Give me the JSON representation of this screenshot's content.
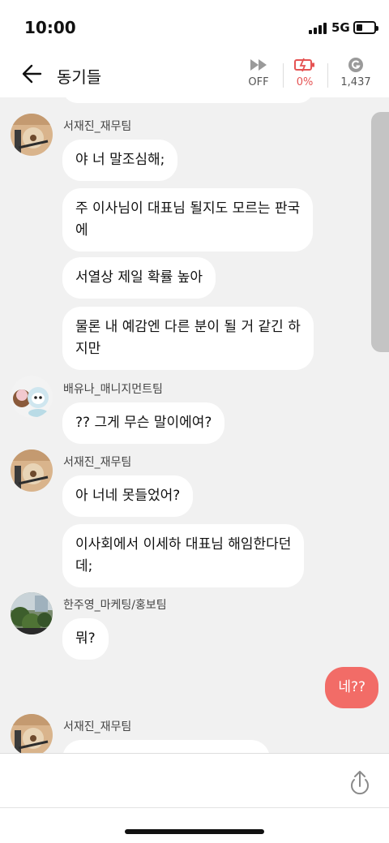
{
  "status_bar": {
    "time": "10:00",
    "network": "5G",
    "battery_level": 0.35
  },
  "header": {
    "title": "동기들",
    "autoplay_label": "OFF",
    "battery_label": "0%",
    "coin_label": "1,437"
  },
  "messages": [
    {
      "sender": "서재진_재무팀",
      "bubbles": [
        "야 너 말조심해;",
        "주 이사님이 대표님 될지도 모르는 판국\n에",
        "서열상 제일 확률 높아",
        "물론 내 예감엔 다른 분이 될 거 같긴 하\n지만"
      ]
    },
    {
      "sender": "배유나_매니지먼트팀",
      "bubbles": [
        "?? 그게 무슨 말이에여?"
      ]
    },
    {
      "sender": "서재진_재무팀",
      "bubbles": [
        "아 너네 못들었어?",
        "이사회에서 이세하 대표님 해임한다던\n데;"
      ]
    },
    {
      "sender": "한주영_마케팅/홍보팀",
      "bubbles": [
        "뭐?"
      ]
    },
    {
      "sender": "",
      "bubbles": [
        "네??"
      ]
    },
    {
      "sender": "서재진_재무팀",
      "bubbles": []
    }
  ],
  "input": {
    "placeholder": ""
  },
  "colors": {
    "my_bubble": "#f26c67",
    "chat_bg": "#f1f1f1",
    "battery_warning": "#e55454"
  }
}
